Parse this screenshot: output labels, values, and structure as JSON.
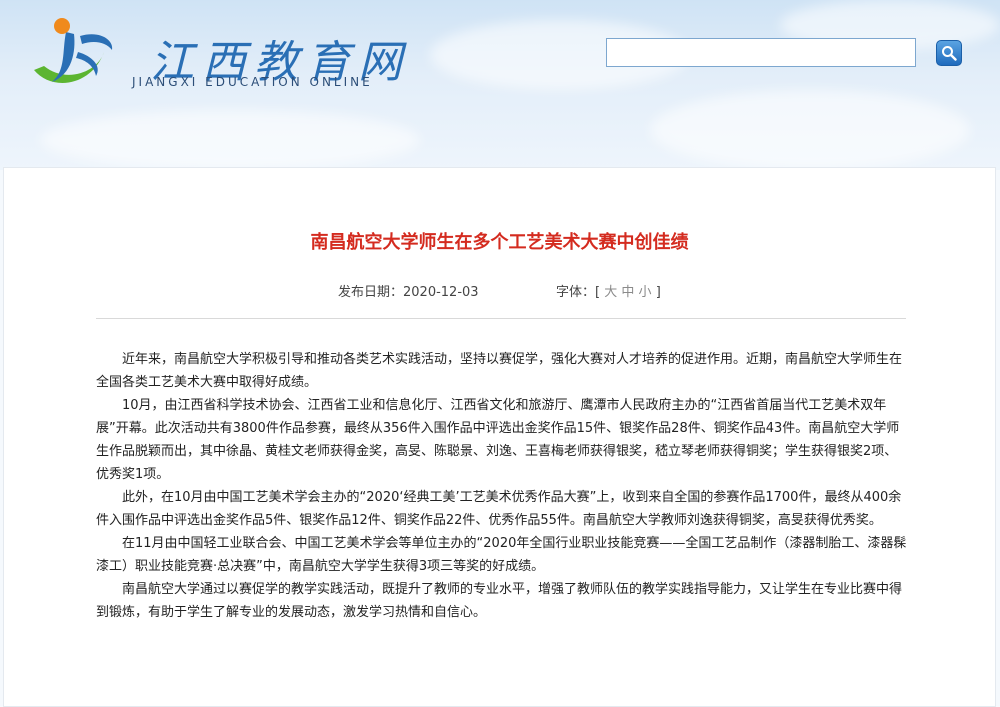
{
  "header": {
    "logo_cn": "江西教育网",
    "logo_en": "JIANGXI EDUCATION ONLINE",
    "search": {
      "value": "",
      "placeholder": ""
    }
  },
  "article": {
    "title": "南昌航空大学师生在多个工艺美术大赛中创佳绩",
    "date_label": "发布日期：2020-12-03",
    "font_label": "字体：",
    "font_open": "[",
    "font_large": "大",
    "font_medium": "中",
    "font_small": "小",
    "font_close": "]",
    "paragraphs": [
      "近年来，南昌航空大学积极引导和推动各类艺术实践活动，坚持以赛促学，强化大赛对人才培养的促进作用。近期，南昌航空大学师生在全国各类工艺美术大赛中取得好成绩。",
      "10月，由江西省科学技术协会、江西省工业和信息化厅、江西省文化和旅游厅、鹰潭市人民政府主办的“江西省首届当代工艺美术双年展”开幕。此次活动共有3800件作品参赛，最终从356件入围作品中评选出金奖作品15件、银奖作品28件、铜奖作品43件。南昌航空大学师生作品脱颖而出，其中徐晶、黄桂文老师获得金奖，高旻、陈聪景、刘逸、王喜梅老师获得银奖，嵇立琴老师获得铜奖；学生获得银奖2项、优秀奖1项。",
      "此外，在10月由中国工艺美术学会主办的“2020‘经典工美’工艺美术优秀作品大赛”上，收到来自全国的参赛作品1700件，最终从400余件入围作品中评选出金奖作品5件、银奖作品12件、铜奖作品22件、优秀作品55件。南昌航空大学教师刘逸获得铜奖，高旻获得优秀奖。",
      "在11月由中国轻工业联合会、中国工艺美术学会等单位主办的“2020年全国行业职业技能竞赛——全国工艺品制作（漆器制胎工、漆器髹漆工）职业技能竞赛·总决赛”中，南昌航空大学学生获得3项三等奖的好成绩。",
      "南昌航空大学通过以赛促学的教学实践活动，既提升了教师的专业水平，增强了教师队伍的教学实践指导能力，又让学生在专业比赛中得到锻炼，有助于学生了解专业的发展动态，激发学习热情和自信心。"
    ]
  },
  "colors": {
    "title": "#d42b1f",
    "logo_blue": "#2a6fb5",
    "logo_green": "#5cb531",
    "logo_orange": "#f08a1c"
  }
}
